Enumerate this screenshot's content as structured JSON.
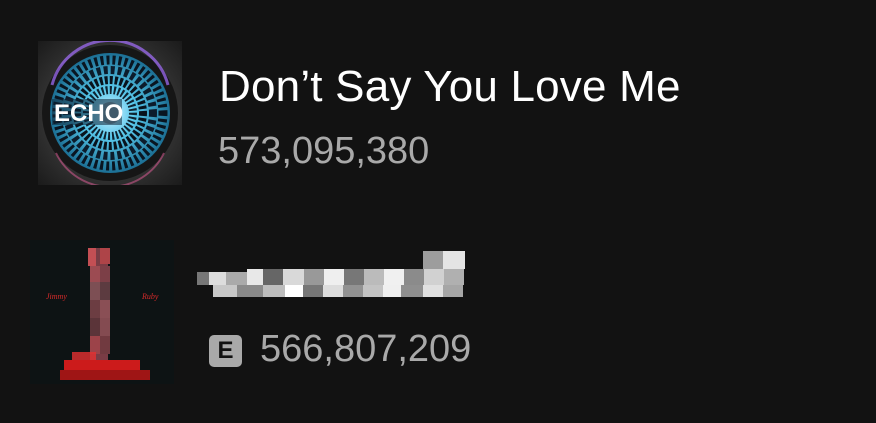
{
  "tracks": [
    {
      "title": "Don’t Say You Love Me",
      "plays": "573,095,380",
      "cover_text": "ECHO"
    },
    {
      "title": "",
      "explicit_label": "E",
      "plays": "566,807,209",
      "cover_left_text": "Jimmy",
      "cover_right_text": "Ruby"
    }
  ],
  "colors": {
    "background": "#121212",
    "title": "#ffffff",
    "secondary_text": "#a9a9a9",
    "cover_accent": "#cc1b1b"
  }
}
